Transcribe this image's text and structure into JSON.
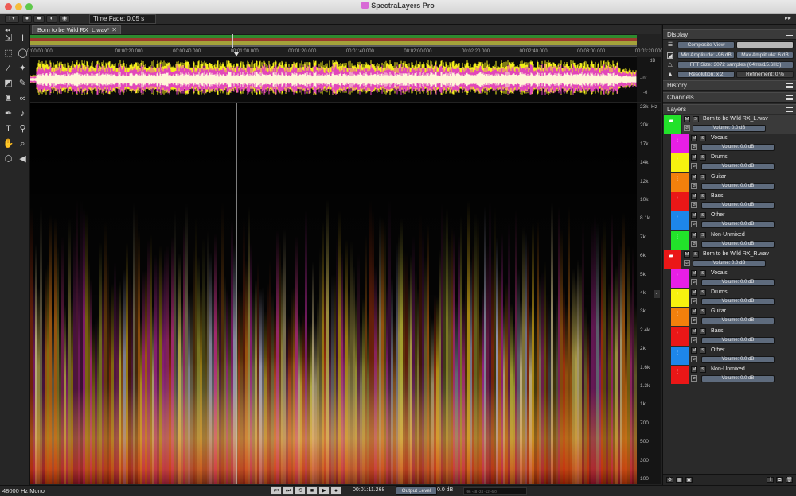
{
  "window": {
    "title": "SpectraLayers Pro"
  },
  "toolbar": {
    "time_fade": "Time Fade: 0.05 s"
  },
  "tab": {
    "label": "Born to be Wild RX_L.wav*",
    "close": "✕"
  },
  "ruler": {
    "ticks": [
      {
        "label": "0:00:00.000",
        "t": 0
      },
      {
        "label": "00:00:20.000",
        "t": 20
      },
      {
        "label": "00:00:40.000",
        "t": 40
      },
      {
        "label": "00:01:00.000",
        "t": 60
      },
      {
        "label": "00:01:20.000",
        "t": 80
      },
      {
        "label": "00:01:40.000",
        "t": 100
      },
      {
        "label": "00:02:00.000",
        "t": 120
      },
      {
        "label": "00:02:20.000",
        "t": 140
      },
      {
        "label": "00:02:40.000",
        "t": 160
      },
      {
        "label": "00:03:00.000",
        "t": 180
      },
      {
        "label": "00:03:20.000",
        "t": 200
      }
    ],
    "total_seconds": 210,
    "playhead_seconds": 71.268
  },
  "waveform": {
    "db_labels": [
      "dB",
      "-inf",
      "-6"
    ]
  },
  "frequency_axis": {
    "unit": "Hz",
    "labels": [
      "23k",
      "20k",
      "17k",
      "14k",
      "12k",
      "10k",
      "8.1k",
      "7k",
      "6k",
      "5k",
      "4k",
      "3k",
      "2.4k",
      "2k",
      "1.6k",
      "1.3k",
      "1k",
      "700",
      "500",
      "300",
      "100"
    ]
  },
  "panel": {
    "display": {
      "title": "Display",
      "view_mode": "Composite View",
      "render_mode": "",
      "min_amplitude": "Min Amplitude: -96 dB",
      "max_amplitude": "Max Amplitude: 6 dB",
      "fft_size": "FFT Size: 3072 samples (64ms/15.6Hz)",
      "resolution": "Resolution: x 2",
      "refinement": "Refinement: 0 %"
    },
    "history": {
      "title": "History"
    },
    "channels": {
      "title": "Channels"
    },
    "layers": {
      "title": "Layers",
      "groups": [
        {
          "name": "Born to be Wild RX_L.wav",
          "color": "#22e22a",
          "volume": "Volume: 0.0 dB",
          "children": [
            {
              "name": "Vocals",
              "color": "#e81ee6",
              "volume": "Volume: 0.0 dB"
            },
            {
              "name": "Drums",
              "color": "#f6f20f",
              "volume": "Volume: 0.0 dB"
            },
            {
              "name": "Guitar",
              "color": "#f2800c",
              "volume": "Volume: 0.0 dB"
            },
            {
              "name": "Bass",
              "color": "#ea1717",
              "volume": "Volume: 0.0 dB"
            },
            {
              "name": "Other",
              "color": "#1d86ea",
              "volume": "Volume: 0.0 dB"
            },
            {
              "name": "Non-Unmixed",
              "color": "#22e22a",
              "volume": "Volume: 0.0 dB"
            }
          ]
        },
        {
          "name": "Born to be Wild RX_R.wav",
          "color": "#ea1717",
          "volume": "Volume: 0.0 dB",
          "children": [
            {
              "name": "Vocals",
              "color": "#e81ee6",
              "volume": "Volume: 0.0 dB"
            },
            {
              "name": "Drums",
              "color": "#f6f20f",
              "volume": "Volume: 0.0 dB"
            },
            {
              "name": "Guitar",
              "color": "#f2800c",
              "volume": "Volume: 0.0 dB"
            },
            {
              "name": "Bass",
              "color": "#ea1717",
              "volume": "Volume: 0.0 dB"
            },
            {
              "name": "Other",
              "color": "#1d86ea",
              "volume": "Volume: 0.0 dB"
            },
            {
              "name": "Non-Unmixed",
              "color": "#ea1717",
              "volume": "Volume: 0.0 dB"
            }
          ]
        }
      ]
    }
  },
  "status": {
    "format": "48000 Hz Mono",
    "timecode": "00:01:11.268",
    "output_level_label": "Output Level",
    "output_level_value": "0.0 dB",
    "meter_ticks": "-96 -48 -24 -12 -6 0"
  },
  "transport": {
    "buttons": [
      {
        "name": "skip-start-icon",
        "glyph": "⏮"
      },
      {
        "name": "skip-end-icon",
        "glyph": "⏭"
      },
      {
        "name": "loop-icon",
        "glyph": "⟲"
      },
      {
        "name": "stop-icon",
        "glyph": "■"
      },
      {
        "name": "play-icon",
        "glyph": "▶"
      },
      {
        "name": "record-icon",
        "glyph": "●"
      }
    ]
  },
  "tools": [
    {
      "name": "time-selection-tool-icon",
      "glyph": "⇲"
    },
    {
      "name": "text-cursor-tool-icon",
      "glyph": "I"
    },
    {
      "name": "rectangle-select-icon",
      "glyph": "⬚"
    },
    {
      "name": "lasso-icon",
      "glyph": "◯"
    },
    {
      "name": "brush-select-icon",
      "glyph": "⁄"
    },
    {
      "name": "magic-wand-icon",
      "glyph": "✦"
    },
    {
      "name": "eraser-icon",
      "glyph": "◩"
    },
    {
      "name": "paint-brush-icon",
      "glyph": "✎"
    },
    {
      "name": "clone-stamp-icon",
      "glyph": "♜"
    },
    {
      "name": "chain-link-icon",
      "glyph": "∞"
    },
    {
      "name": "pen-icon",
      "glyph": "✒"
    },
    {
      "name": "tone-icon",
      "glyph": "♪"
    },
    {
      "name": "pitch-tool-icon",
      "glyph": "Ƭ"
    },
    {
      "name": "eyedropper-icon",
      "glyph": "⚲"
    },
    {
      "name": "hand-icon",
      "glyph": "✋"
    },
    {
      "name": "zoom-icon",
      "glyph": "⌕"
    },
    {
      "name": "cube-icon",
      "glyph": "⬡"
    },
    {
      "name": "speaker-icon",
      "glyph": "◀"
    }
  ]
}
